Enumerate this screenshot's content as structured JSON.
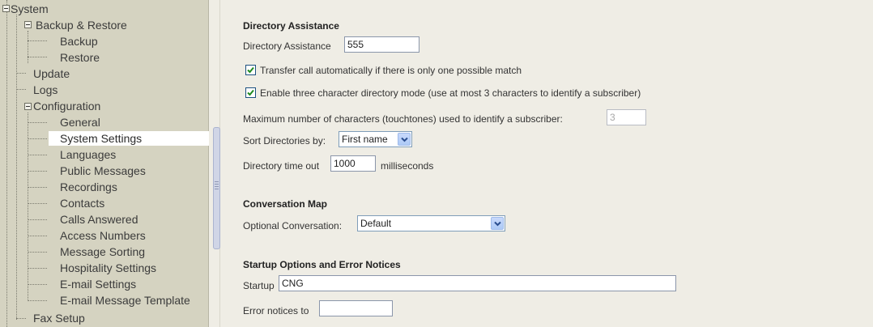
{
  "tree": {
    "items": [
      {
        "label": "System"
      },
      {
        "label": "Backup & Restore"
      },
      {
        "label": "Backup"
      },
      {
        "label": "Restore"
      },
      {
        "label": "Update"
      },
      {
        "label": "Logs"
      },
      {
        "label": "Configuration"
      },
      {
        "label": "General"
      },
      {
        "label": "System Settings"
      },
      {
        "label": "Languages"
      },
      {
        "label": "Public Messages"
      },
      {
        "label": "Recordings"
      },
      {
        "label": "Contacts"
      },
      {
        "label": "Calls Answered"
      },
      {
        "label": "Access Numbers"
      },
      {
        "label": "Message Sorting"
      },
      {
        "label": "Hospitality Settings"
      },
      {
        "label": "E-mail Settings"
      },
      {
        "label": "E-mail Message Template"
      },
      {
        "label": "Fax Setup"
      }
    ]
  },
  "directory": {
    "title": "Directory Assistance",
    "assist_label": "Directory Assistance",
    "assist_value": "555",
    "transfer_label": "Transfer call automatically if there is only one possible match",
    "transfer_checked": true,
    "three_char_label": "Enable three character directory mode (use at most 3 characters to identify a subscriber)",
    "three_char_checked": true,
    "max_chars_label": "Maximum number of characters (touchtones) used to identify a subscriber:",
    "max_chars_value": "3",
    "sort_label": "Sort Directories by:",
    "sort_value": "First name",
    "timeout_label": "Directory time out",
    "timeout_value": "1000",
    "timeout_unit": "milliseconds"
  },
  "conversation": {
    "title": "Conversation Map",
    "optional_label": "Optional Conversation:",
    "optional_value": "Default"
  },
  "startup": {
    "title": "Startup Options and Error Notices",
    "startup_label": "Startup",
    "startup_value": "CNG",
    "error_label": "Error notices to",
    "error_value": ""
  }
}
